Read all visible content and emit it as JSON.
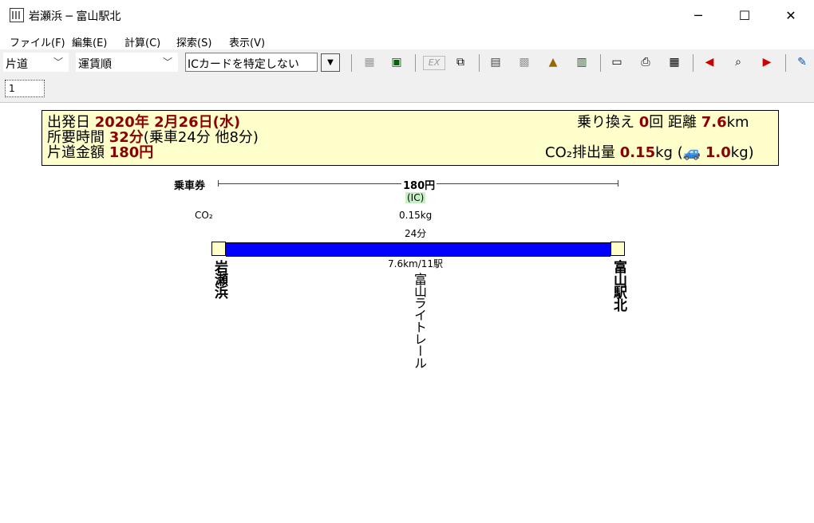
{
  "window": {
    "title": "岩瀬浜 ─ 富山駅北",
    "minimize": "─",
    "maximize": "☐",
    "close": "✕"
  },
  "menu": [
    "ファイル(F)",
    "編集(E)",
    "計算(C)",
    "探索(S)",
    "表示(V)"
  ],
  "toolbar": {
    "trip_type": "片道",
    "sort_order": "運賃順",
    "ic_card": "ICカードを特定しない",
    "dropdown_arrow": "▼",
    "icons": [
      "calendar-icon",
      "timetable-icon",
      "ex-icon",
      "print-preview-icon",
      "station-icon",
      "ic-card-icon",
      "map-icon",
      "search-icon",
      "memo-icon",
      "printer-icon",
      "fare-table-icon",
      "prev-route-icon",
      "route-search-icon",
      "next-route-icon",
      "edit-icon"
    ]
  },
  "tabs": [
    "1"
  ],
  "summary": {
    "departure_label": "出発日",
    "departure_value": "2020年 2月26日(水)",
    "duration_label": "所要時間",
    "duration_value": "32分",
    "duration_detail": "(乗車24分 他8分)",
    "fare_label": "片道金額",
    "fare_value": "180円",
    "transfers_label": "乗り換え",
    "transfers_value": "0",
    "transfers_unit": "回",
    "distance_label": "距離",
    "distance_value": "7.6",
    "distance_unit": "km",
    "co2_label": "CO₂排出量",
    "co2_value": "0.15",
    "co2_unit": "kg",
    "car_co2_value": "1.0",
    "car_co2_unit": "kg"
  },
  "route": {
    "ticket_label": "乗車券",
    "fare": "180円",
    "ic_badge": "(IC)",
    "co2_label": "CO₂",
    "co2_value": "0.15kg",
    "ride_time": "24分",
    "distance_stations": "7.6km/11駅",
    "origin": "岩瀬浜",
    "destination": "富山駅北",
    "line_name": "富山ライトレール"
  }
}
